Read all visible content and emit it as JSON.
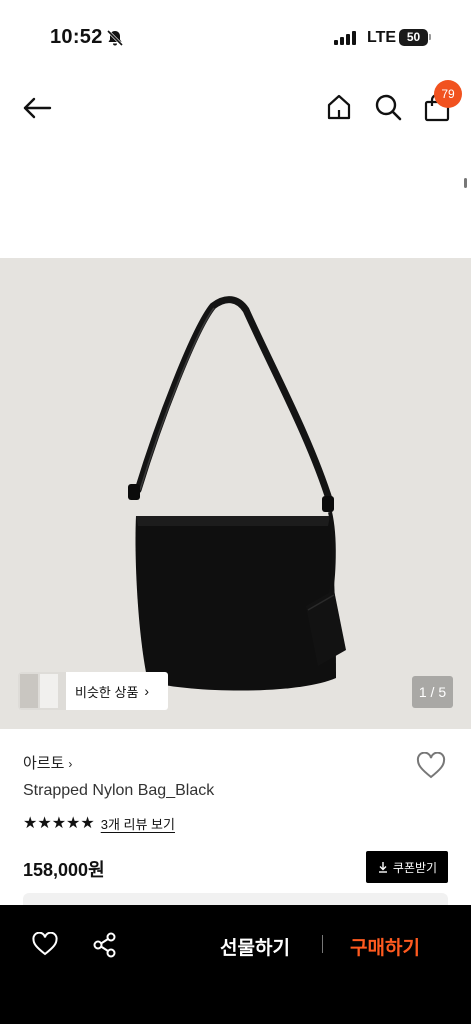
{
  "status_bar": {
    "time": "10:52",
    "network": "LTE",
    "battery": "50",
    "icons": [
      "bell-off-icon",
      "signal-icon"
    ]
  },
  "header": {
    "cart_count": "79",
    "icons": [
      "back-arrow-icon",
      "home-icon",
      "search-icon",
      "shopping-bag-icon"
    ],
    "badge_color": "#f1521f"
  },
  "gallery": {
    "background": "#e5e3df",
    "similar_label": "비슷한 상품",
    "similar_chevron": "›",
    "counter": "1 / 5"
  },
  "product": {
    "brand": "아르토",
    "brand_chevron": "›",
    "name": "Strapped Nylon Bag_Black",
    "stars": "★★★★★",
    "rating_value": 5,
    "review_link": "3개 리뷰 보기",
    "price": "158,000원",
    "coupon_label": "쿠폰받기",
    "coupon_icon": "download-icon"
  },
  "bottom_bar": {
    "gift_label": "선물하기",
    "buy_label": "구매하기",
    "buy_color": "#ff5a1f",
    "icons": [
      "heart-outline-icon",
      "share-icon"
    ]
  }
}
